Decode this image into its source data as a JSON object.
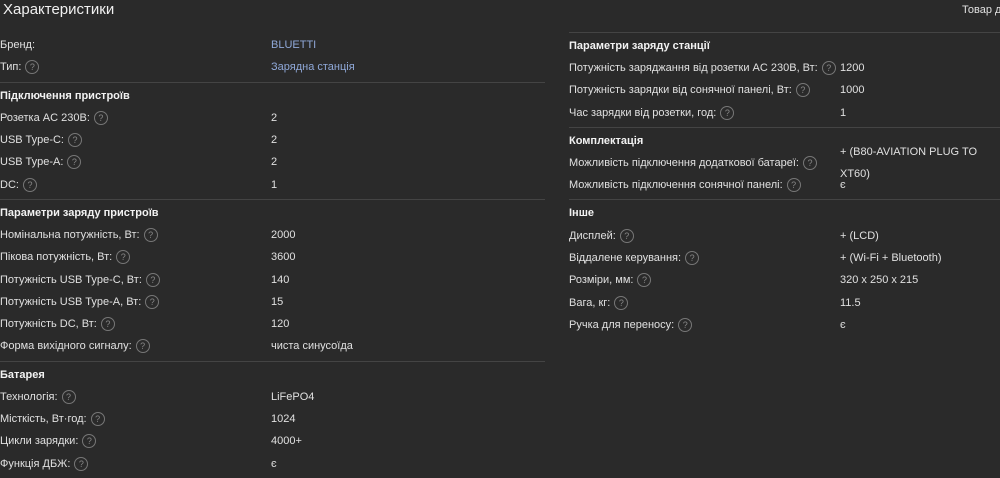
{
  "title": "Характеристики",
  "availability": "Товар до",
  "left": [
    {
      "header": null,
      "rows": [
        {
          "label": "Бренд:",
          "value": "BLUETTI",
          "help": false,
          "link": true
        },
        {
          "label": "Тип:",
          "value": "Зарядна станція",
          "help": true,
          "link": true
        }
      ]
    },
    {
      "header": "Підключення пристроїв",
      "rows": [
        {
          "label": "Розетка AC 230В:",
          "value": "2",
          "help": true
        },
        {
          "label": "USB Type-C:",
          "value": "2",
          "help": true
        },
        {
          "label": "USB Type-A:",
          "value": "2",
          "help": true
        },
        {
          "label": "DC:",
          "value": "1",
          "help": true
        }
      ]
    },
    {
      "header": "Параметри заряду пристроїв",
      "rows": [
        {
          "label": "Номінальна потужність, Вт:",
          "value": "2000",
          "help": true
        },
        {
          "label": "Пікова потужність, Вт:",
          "value": "3600",
          "help": true
        },
        {
          "label": "Потужність USB Type-C, Вт:",
          "value": "140",
          "help": true
        },
        {
          "label": "Потужність USB Type-A, Вт:",
          "value": "15",
          "help": true
        },
        {
          "label": "Потужність DC, Вт:",
          "value": "120",
          "help": true
        },
        {
          "label": "Форма вихідного сигналу:",
          "value": "чиста синусоїда",
          "help": true
        }
      ]
    },
    {
      "header": "Батарея",
      "rows": [
        {
          "label": "Технологія:",
          "value": "LiFePO4",
          "help": true
        },
        {
          "label": "Місткість, Вт·год:",
          "value": "1024",
          "help": true
        },
        {
          "label": "Цикли зарядки:",
          "value": "4000+",
          "help": true
        },
        {
          "label": "Функція ДБЖ:",
          "value": "є",
          "help": true
        }
      ]
    }
  ],
  "right": [
    {
      "header": "Параметри заряду станції",
      "rows": [
        {
          "label": "Потужність заряджання від розетки AC 230В, Вт:",
          "value": "1200",
          "help": true
        },
        {
          "label": "Потужність зарядки від сонячної панелі, Вт:",
          "value": "1000",
          "help": true
        },
        {
          "label": "Час зарядки від розетки, год:",
          "value": "1",
          "help": true
        }
      ]
    },
    {
      "header": "Комплектація",
      "rows": [
        {
          "label": "Можливість підключення додаткової батареї:",
          "value": "+ (B80-AVIATION PLUG TO XT60)",
          "help": true
        },
        {
          "label": "Можливість підключення сонячної панелі:",
          "value": "є",
          "help": true
        }
      ]
    },
    {
      "header": "Інше",
      "rows": [
        {
          "label": "Дисплей:",
          "value": "+ (LCD)",
          "help": true
        },
        {
          "label": "Віддалене керування:",
          "value": "+ (Wi-Fi + Bluetooth)",
          "help": true
        },
        {
          "label": "Розміри, мм:",
          "value": "320 x 250 x 215",
          "help": true
        },
        {
          "label": "Вага, кг:",
          "value": "11.5",
          "help": true
        },
        {
          "label": "Ручка для переносу:",
          "value": "є",
          "help": true
        }
      ]
    }
  ],
  "help_glyph": "?"
}
